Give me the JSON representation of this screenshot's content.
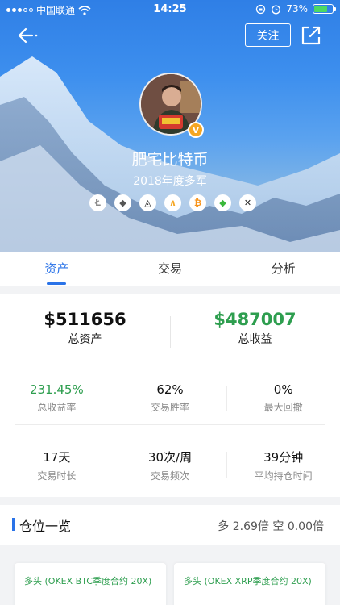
{
  "status_bar": {
    "carrier": "中国联通",
    "time": "14:25",
    "battery_text": "73%",
    "battery_level": 0.73
  },
  "header": {
    "follow_label": "关注",
    "back_icon": "back-arrow-icon",
    "share_icon": "share-icon"
  },
  "profile": {
    "nickname": "肥宅比特币",
    "subtitle": "2018年度多军",
    "badge": "V",
    "coins": [
      {
        "name": "litecoin-icon",
        "symbol": "Ł",
        "color": "#8a8a8a"
      },
      {
        "name": "ethereum-icon",
        "symbol": "◆",
        "color": "#555"
      },
      {
        "name": "eos-icon",
        "symbol": "◬",
        "color": "#111"
      },
      {
        "name": "aeternity-icon",
        "symbol": "∧",
        "color": "#f5a623"
      },
      {
        "name": "bitcoin-icon",
        "symbol": "₿",
        "color": "#f7931a"
      },
      {
        "name": "ethereum-classic-icon",
        "symbol": "◆",
        "color": "#3ab83a"
      },
      {
        "name": "ripple-icon",
        "symbol": "✕",
        "color": "#222"
      }
    ]
  },
  "tabs": [
    {
      "label": "资产",
      "active": true
    },
    {
      "label": "交易",
      "active": false
    },
    {
      "label": "分析",
      "active": false
    }
  ],
  "totals": [
    {
      "value": "$511656",
      "label": "总资产",
      "highlight": false
    },
    {
      "value": "$487007",
      "label": "总收益",
      "highlight": true
    }
  ],
  "stats_row1": [
    {
      "value": "231.45%",
      "label": "总收益率",
      "highlight": true
    },
    {
      "value": "62%",
      "label": "交易胜率",
      "highlight": false
    },
    {
      "value": "0%",
      "label": "最大回撤",
      "highlight": false
    }
  ],
  "stats_row2": [
    {
      "value": "17天",
      "label": "交易时长"
    },
    {
      "value": "30次/周",
      "label": "交易频次"
    },
    {
      "value": "39分钟",
      "label": "平均持仓时间"
    }
  ],
  "positions": {
    "title": "仓位一览",
    "summary": "多 2.69倍 空 0.00倍",
    "items": [
      {
        "label": "多头 (OKEX BTC季度合约 20X)"
      },
      {
        "label": "多头 (OKEX XRP季度合约 20X)"
      }
    ]
  },
  "colors": {
    "accent": "#2a73e8",
    "positive": "#2e9e4f"
  }
}
